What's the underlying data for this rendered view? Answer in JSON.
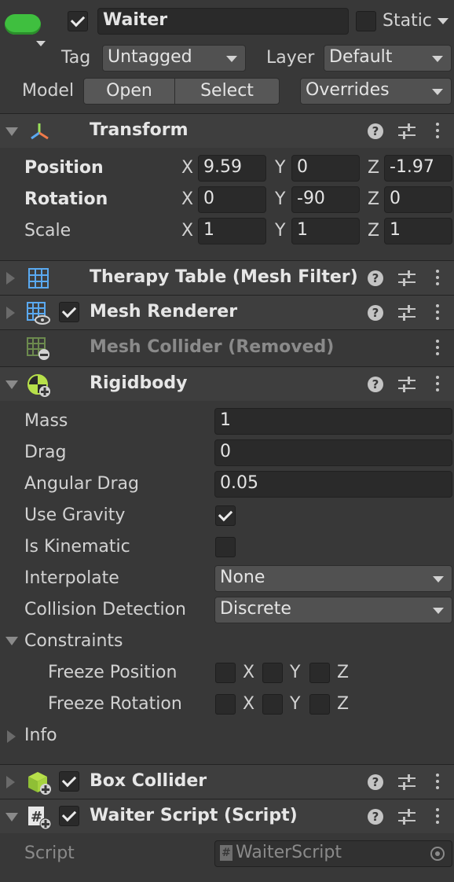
{
  "object": {
    "active": true,
    "name": "Waiter",
    "static_label": "Static",
    "static_checked": false,
    "tag_label": "Tag",
    "tag_value": "Untagged",
    "layer_label": "Layer",
    "layer_value": "Default",
    "model_label": "Model",
    "open_label": "Open",
    "select_label": "Select",
    "overrides_label": "Overrides"
  },
  "transform": {
    "title": "Transform",
    "rows": [
      {
        "label": "Position",
        "x": "9.59",
        "y": "0",
        "z": "-1.97"
      },
      {
        "label": "Rotation",
        "x": "0",
        "y": "-90",
        "z": "0"
      },
      {
        "label": "Scale",
        "x": "1",
        "y": "1",
        "z": "1"
      }
    ],
    "axis_x": "X",
    "axis_y": "Y",
    "axis_z": "Z"
  },
  "components": {
    "mesh_filter": "Therapy Table (Mesh Filter)",
    "mesh_renderer": "Mesh Renderer",
    "mesh_collider": "Mesh Collider (Removed)",
    "rigidbody": "Rigidbody",
    "box_collider": "Box Collider",
    "waiter_script": "Waiter Script (Script)"
  },
  "rigidbody": {
    "mass_label": "Mass",
    "mass": "1",
    "drag_label": "Drag",
    "drag": "0",
    "angular_drag_label": "Angular Drag",
    "angular_drag": "0.05",
    "use_gravity_label": "Use Gravity",
    "use_gravity": true,
    "is_kinematic_label": "Is Kinematic",
    "is_kinematic": false,
    "interpolate_label": "Interpolate",
    "interpolate": "None",
    "collision_label": "Collision Detection",
    "collision": "Discrete",
    "constraints_label": "Constraints",
    "freeze_position_label": "Freeze Position",
    "freeze_rotation_label": "Freeze Rotation",
    "info_label": "Info"
  },
  "script": {
    "label": "Script",
    "value": "WaiterScript"
  },
  "colors": {
    "background": "#383838",
    "header": "#3e3e3e",
    "field": "#2a2a2a",
    "object_icon": "#3fbf3f"
  }
}
